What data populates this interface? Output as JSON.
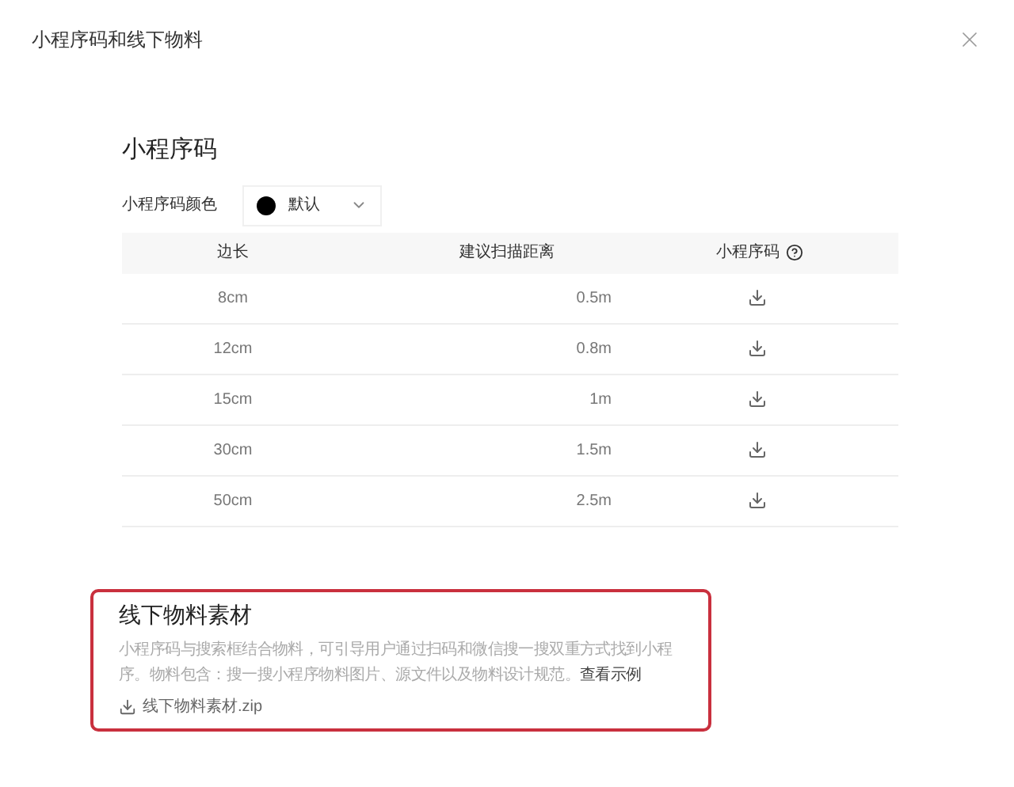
{
  "window": {
    "title": "小程序码和线下物料"
  },
  "section": {
    "title": "小程序码",
    "color_label": "小程序码颜色",
    "color_select": {
      "value": "默认",
      "color": "#000000"
    }
  },
  "table": {
    "columns": [
      "边长",
      "建议扫描距离",
      "小程序码"
    ],
    "rows": [
      {
        "size": "8cm",
        "distance": "0.5m"
      },
      {
        "size": "12cm",
        "distance": "0.8m"
      },
      {
        "size": "15cm",
        "distance": "1m"
      },
      {
        "size": "30cm",
        "distance": "1.5m"
      },
      {
        "size": "50cm",
        "distance": "2.5m"
      }
    ]
  },
  "materials": {
    "title": "线下物料素材",
    "description": "小程序码与搜索框结合物料，可引导用户通过扫码和微信搜一搜双重方式找到小程序。物料包含：搜一搜小程序物料图片、源文件以及物料设计规范。",
    "link": "查看示例",
    "file": "线下物料素材.zip"
  }
}
